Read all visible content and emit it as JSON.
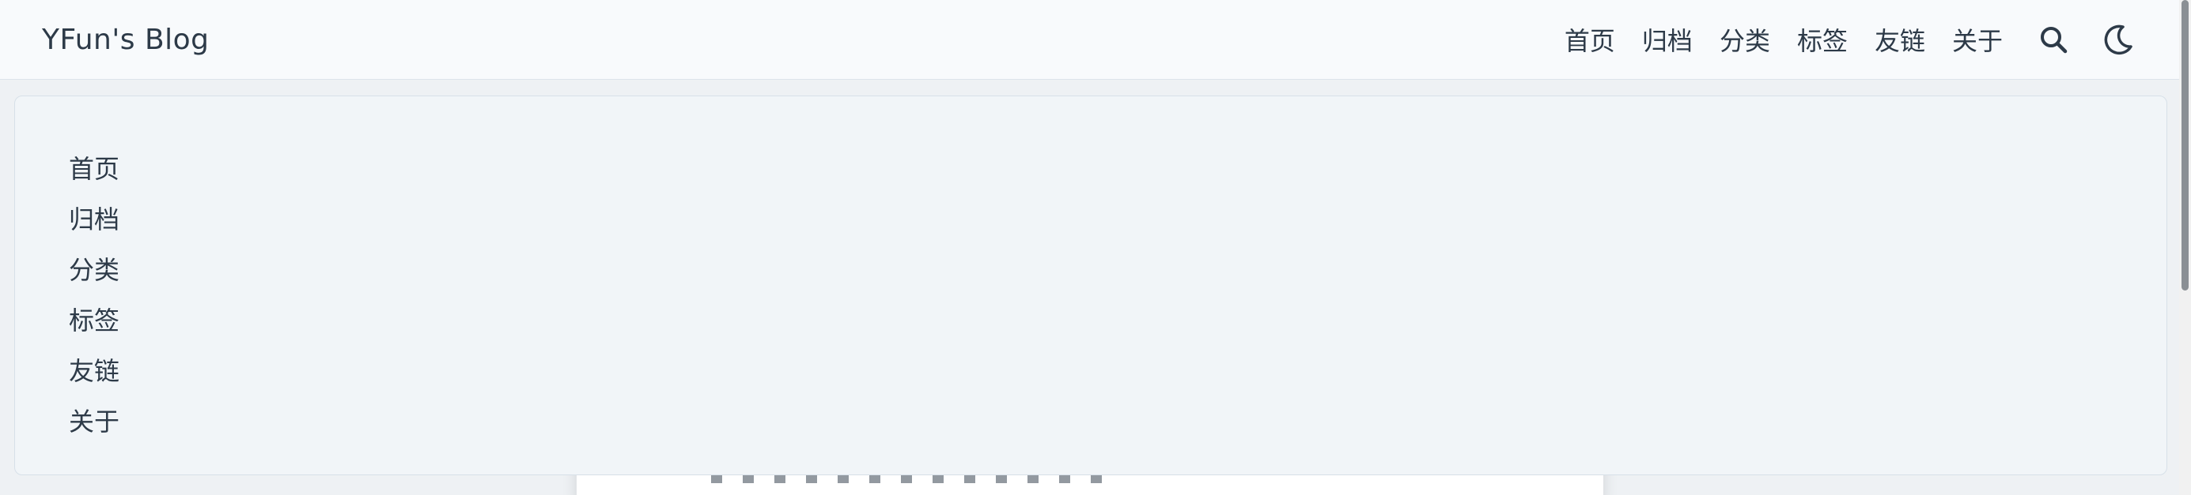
{
  "brand": {
    "title": "YFun's Blog"
  },
  "nav": {
    "links": [
      "首页",
      "归档",
      "分类",
      "标签",
      "友链",
      "关于"
    ],
    "icons": {
      "search": "search-icon",
      "theme": "moon-icon"
    }
  },
  "menu": {
    "items": [
      "首页",
      "归档",
      "分类",
      "标签",
      "友链",
      "关于"
    ]
  },
  "colors": {
    "text": "#2d3a48",
    "navbar_bg": "#f8fafc",
    "panel_bg": "#f1f5f8",
    "page_bg": "#eef1f4"
  }
}
